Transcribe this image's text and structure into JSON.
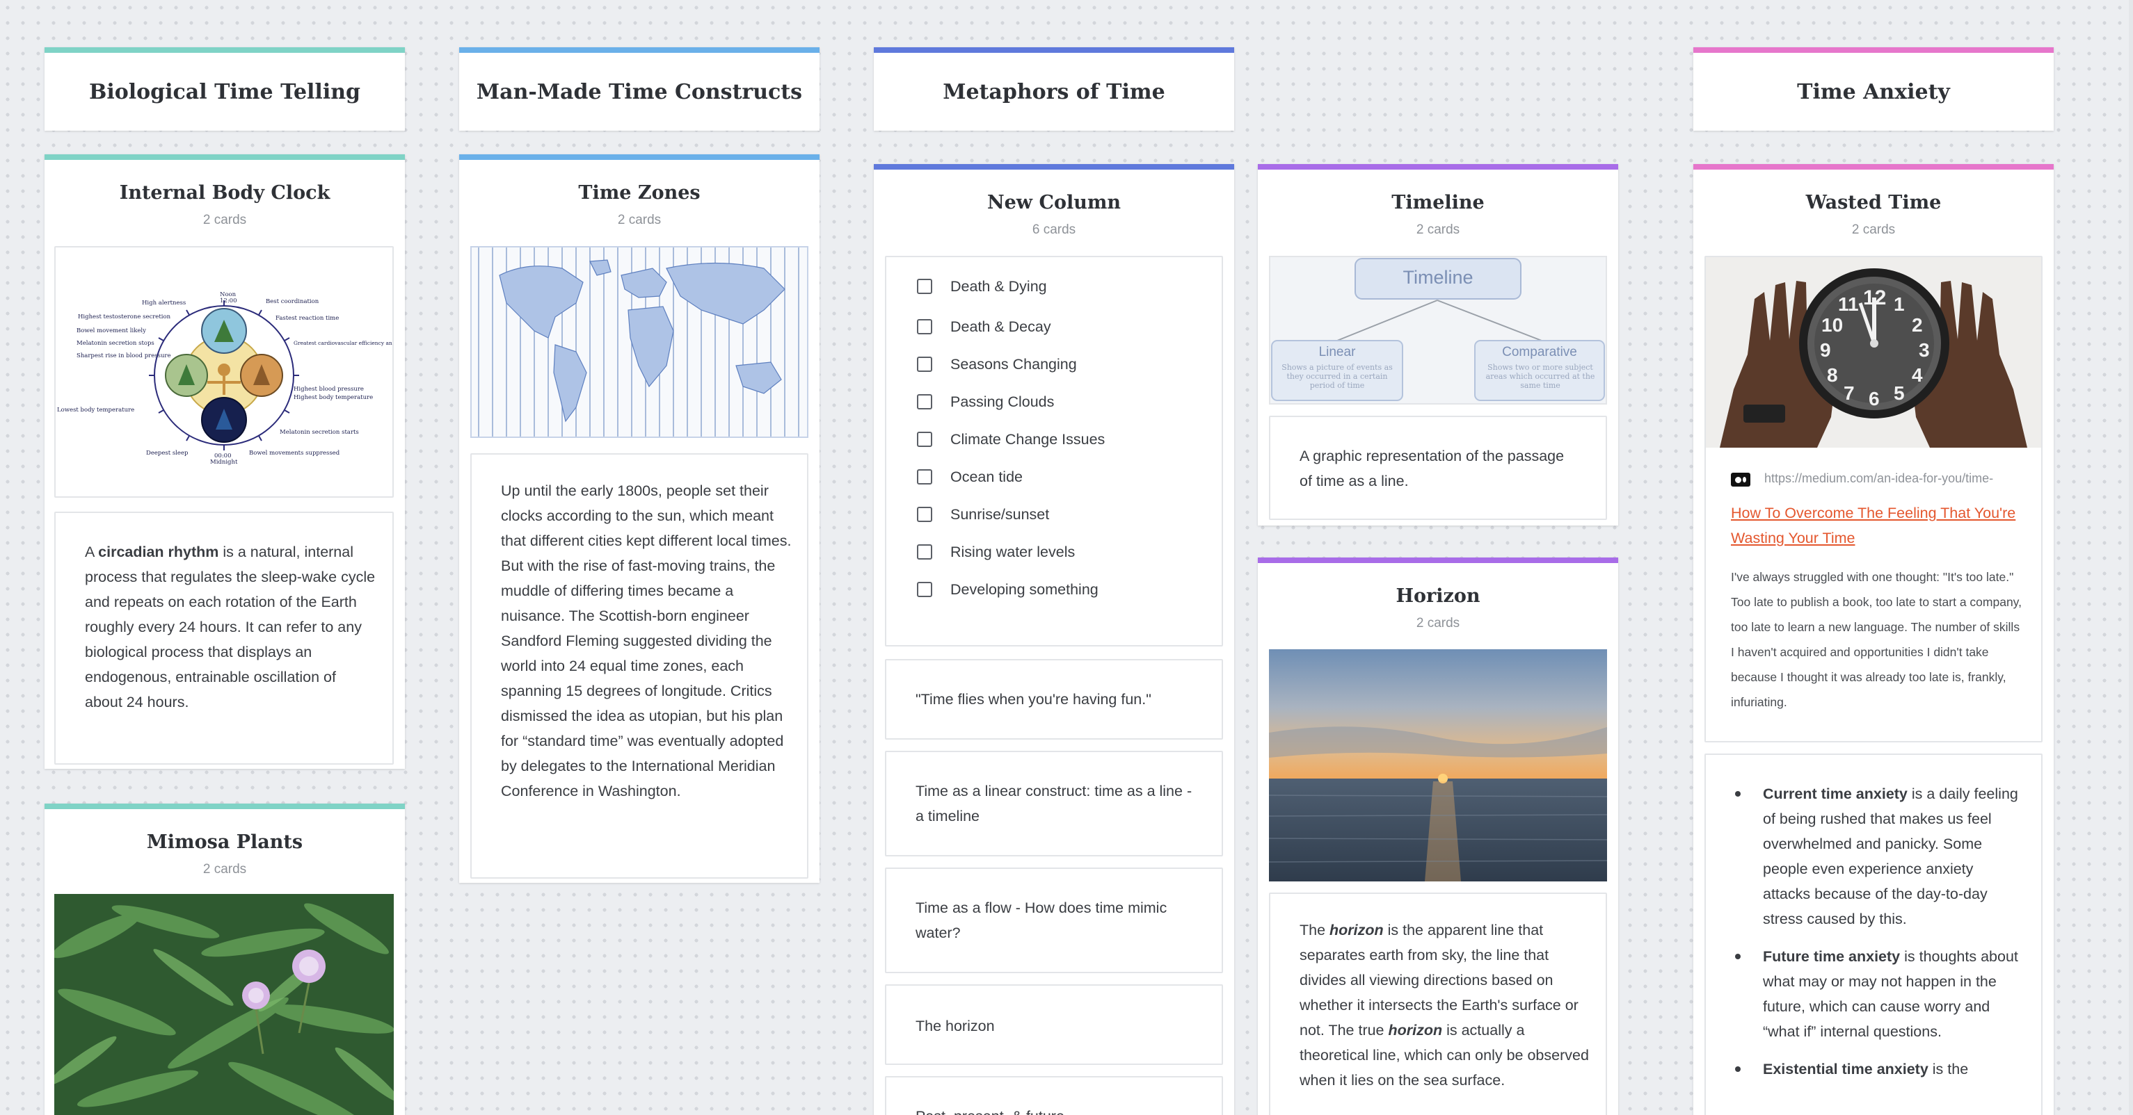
{
  "colors": {
    "teal": "#7fd3c6",
    "blue_light": "#6ab0e9",
    "blue_dark": "#5f79dc",
    "purple": "#a86ce8",
    "pink": "#e676cb",
    "link": "#e4572e"
  },
  "columns": {
    "biological": "Biological Time Telling",
    "manmade": "Man-Made Time Constructs",
    "metaphors": "Metaphors of Time",
    "anxiety": "Time Anxiety"
  },
  "internal_body_clock": {
    "title": "Internal Body Clock",
    "count": "2 cards",
    "diagram_labels": {
      "noon": "Noon",
      "noon_time": "12:00",
      "midnight": "Midnight",
      "midnight_time": "00:00",
      "high_alertness": "High alertness",
      "best_coordination": "Best coordination",
      "high_testosterone": "Highest testosterone secretion",
      "fastest_reaction": "Fastest reaction time",
      "bowel_movement": "Bowel movement likely",
      "melatonin_stops": "Melatonin secretion stops",
      "cardio": "Greatest cardiovascular efficiency and muscle strength",
      "bp_rise": "Sharpest rise in blood pressure",
      "highest_bp": "Highest blood pressure",
      "highest_temp": "Highest body temperature",
      "lowest_temp": "Lowest body temperature",
      "melatonin_starts": "Melatonin secretion starts",
      "deepest_sleep": "Deepest sleep",
      "bowel_suppressed": "Bowel movements suppressed"
    },
    "text_prefix": "A ",
    "text_bold": "circadian rhythm",
    "text_rest": " is a natural, internal process that regulates the sleep-wake cycle and repeats on each rotation of the Earth roughly every 24 hours. It can refer to any biological process that displays an endogenous, entrainable oscillation of about 24 hours."
  },
  "mimosa": {
    "title": "Mimosa Plants",
    "count": "2 cards"
  },
  "time_zones": {
    "title": "Time Zones",
    "count": "2 cards",
    "text": "Up until the early 1800s, people set their clocks according to the sun, which meant that different cities kept different local times. But with the rise of fast-moving trains, the muddle of differing times became a nuisance. The Scottish-born engineer Sandford Fleming suggested dividing the world into 24 equal time zones, each spanning 15 degrees of longitude. Critics dismissed the idea as utopian, but his plan for “standard time” was eventually adopted by delegates to the International Meridian Conference in Washington."
  },
  "new_column": {
    "title": "New Column",
    "count": "6 cards",
    "checklist": [
      "Death & Dying",
      "Death & Decay",
      "Seasons Changing",
      "Passing Clouds",
      "Climate Change Issues",
      "Ocean tide",
      "Sunrise/sunset",
      "Rising water levels",
      "Developing something"
    ],
    "cards": [
      "\"Time flies when you're having fun.\"",
      "Time as a linear construct: time as a line - a timeline",
      "Time as a flow - How does time mimic water?",
      "The horizon",
      "Past, present, & future"
    ]
  },
  "timeline": {
    "title": "Timeline",
    "count": "2 cards",
    "diagram_title": "Timeline",
    "linear": "Linear",
    "linear_desc": "Shows a picture of events as they occurred in a certain period of time",
    "comparative": "Comparative",
    "comparative_desc": "Shows two or more subject areas which occurred at the same time",
    "text": "A graphic representation of the passage of time as a line."
  },
  "horizon": {
    "title": "Horizon",
    "count": "2 cards",
    "t1": "The ",
    "t2": "horizon",
    "t3": " is the apparent line that separates earth from sky, the line that divides all viewing directions based on whether it intersects the Earth's surface or not. The true ",
    "t4": "horizon",
    "t5": " is actually a theoretical line, which can only be observed when it lies on the sea surface."
  },
  "wasted_time": {
    "title": "Wasted Time",
    "count": "2 cards",
    "clock_numbers": [
      "12",
      "1",
      "2",
      "3",
      "4",
      "5",
      "6",
      "7",
      "8",
      "9",
      "10",
      "11"
    ],
    "url": "https://medium.com/an-idea-for-you/time-",
    "link_title": "How To Overcome The Feeling That You're Wasting Your Time",
    "excerpt": "I've always struggled with one thought: \"It's too late.\" Too late to publish a book, too late to start a company, too late to learn a new language. The number of skills I haven't acquired and opportunities I didn't take because I thought it was already too late is, frankly, infuriating.",
    "b1_bold": "Current time anxiety",
    "b1_rest": " is a daily feeling of being rushed that makes us feel overwhelmed and panicky. Some people even experience anxiety attacks because of the day-to-day stress caused by this.",
    "b2_bold": "Future time anxiety",
    "b2_rest": " is thoughts about what may or may not happen in the future, which can cause worry and “what if” internal questions.",
    "b3_bold": "Existential time anxiety",
    "b3_rest": " is the"
  }
}
